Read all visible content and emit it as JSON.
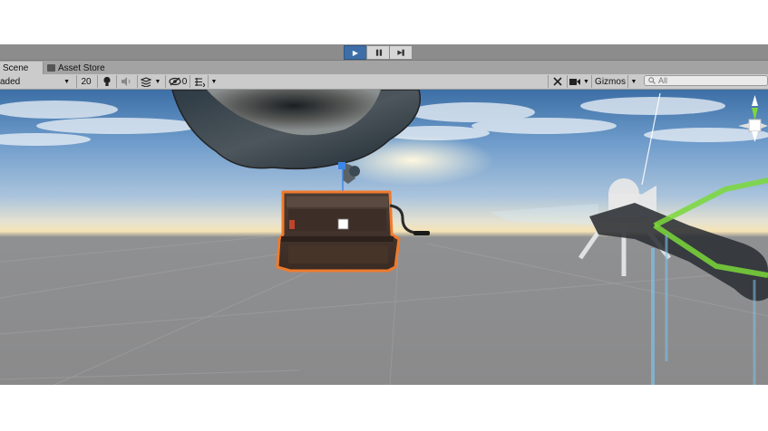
{
  "playbar": {
    "play_glyph": "▶",
    "pause_glyph": "❚❚",
    "step_glyph": "▶❚"
  },
  "tabs": {
    "scene": "Scene",
    "asset_store": "Asset Store"
  },
  "toolbar": {
    "shading_mode": "aded",
    "mode_2d": "20",
    "hidden_count": "0",
    "gizmos": "Gizmos",
    "search_placeholder": "All"
  },
  "colors": {
    "selection_outline": "#f07a2c",
    "play_active": "#3e6ea8",
    "gizmo_y": "#7ad83a",
    "gizmo_z": "#3c86e8"
  },
  "icons": [
    "play-icon",
    "pause-icon",
    "step-icon",
    "asset-store-icon",
    "lightbulb-icon",
    "audio-icon",
    "effects-icon",
    "visibility-icon",
    "grid-icon",
    "tools-icon",
    "camera-icon",
    "search-icon",
    "camera-gizmo-icon"
  ]
}
